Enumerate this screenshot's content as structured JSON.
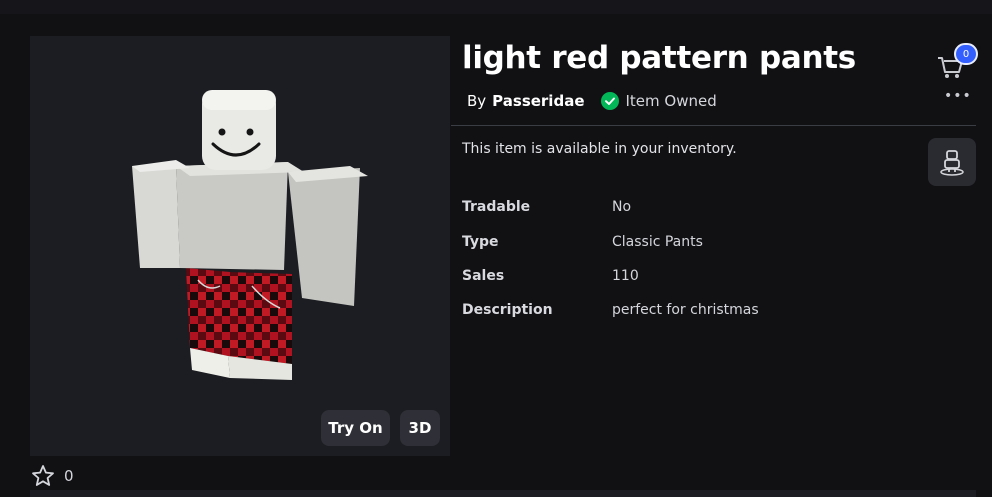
{
  "item": {
    "title": "light red pattern pants",
    "by_prefix": "By",
    "creator": "Passeridae",
    "owned_label": "Item Owned",
    "availability": "This item is available in your inventory."
  },
  "details": [
    {
      "label": "Tradable",
      "value": "No"
    },
    {
      "label": "Type",
      "value": "Classic Pants"
    },
    {
      "label": "Sales",
      "value": "110"
    },
    {
      "label": "Description",
      "value": "perfect for christmas"
    }
  ],
  "viewer": {
    "try_on_label": "Try On",
    "view_3d_label": "3D"
  },
  "cart": {
    "count": "0",
    "icon": "cart-icon"
  },
  "favorites": {
    "count": "0",
    "icon": "star-icon"
  },
  "colors": {
    "background": "#111114",
    "panel": "#1b1d22",
    "accent": "#335fff",
    "owned": "#02b757",
    "pants_red": "#b0131f"
  }
}
